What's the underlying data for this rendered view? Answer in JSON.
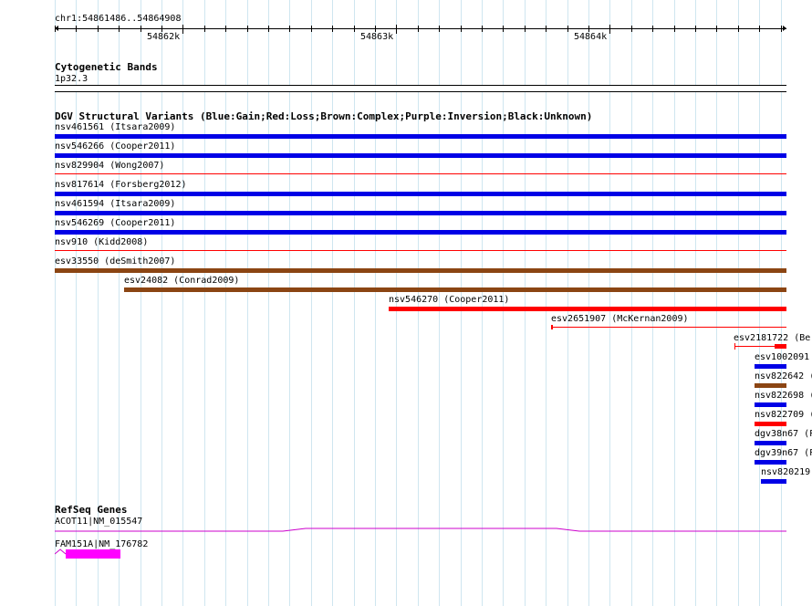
{
  "ruler": {
    "position": "chr1:54861486..54864908",
    "ticks": [
      "54862k",
      "54863k",
      "54864k"
    ]
  },
  "cytoband": {
    "title": "Cytogenetic Bands",
    "band": "1p32.3"
  },
  "dgv": {
    "title": "DGV Structural Variants (Blue:Gain;Red:Loss;Brown:Complex;Purple:Inversion;Black:Unknown)",
    "colors": {
      "gain": "#0000e6",
      "loss": "#ff0000",
      "complex": "#8b4513"
    },
    "features": [
      {
        "label": "nsv461561 (Itsara2009)",
        "type": "gain"
      },
      {
        "label": "nsv546266 (Cooper2011)",
        "type": "gain"
      },
      {
        "label": "nsv829904 (Wong2007)",
        "type": "loss"
      },
      {
        "label": "nsv817614 (Forsberg2012)",
        "type": "gain"
      },
      {
        "label": "nsv461594 (Itsara2009)",
        "type": "gain"
      },
      {
        "label": "nsv546269 (Cooper2011)",
        "type": "gain"
      },
      {
        "label": "nsv910 (Kidd2008)",
        "type": "loss"
      },
      {
        "label": "esv33550 (deSmith2007)",
        "type": "complex"
      },
      {
        "label": "esv24082 (Conrad2009)",
        "type": "complex"
      },
      {
        "label": "nsv546270 (Cooper2011)",
        "type": "loss"
      },
      {
        "label": "esv2651907 (McKernan2009)",
        "type": "loss"
      },
      {
        "label": "esv2181722 (Ber",
        "type": "loss"
      },
      {
        "label": "esv1002091",
        "type": "gain"
      },
      {
        "label": "nsv822642 (",
        "type": "complex"
      },
      {
        "label": "nsv822698 (",
        "type": "gain"
      },
      {
        "label": "nsv822709 (",
        "type": "loss"
      },
      {
        "label": "dgv38n67 (P",
        "type": "gain"
      },
      {
        "label": "dgv39n67 (P",
        "type": "gain"
      },
      {
        "label": "nsv820219",
        "type": "gain"
      }
    ]
  },
  "refseq": {
    "title": "RefSeq Genes",
    "color": "#ff00ff",
    "genes": [
      {
        "label": "ACOT11|NM_015547"
      },
      {
        "label": "FAM151A|NM_176782"
      }
    ]
  }
}
